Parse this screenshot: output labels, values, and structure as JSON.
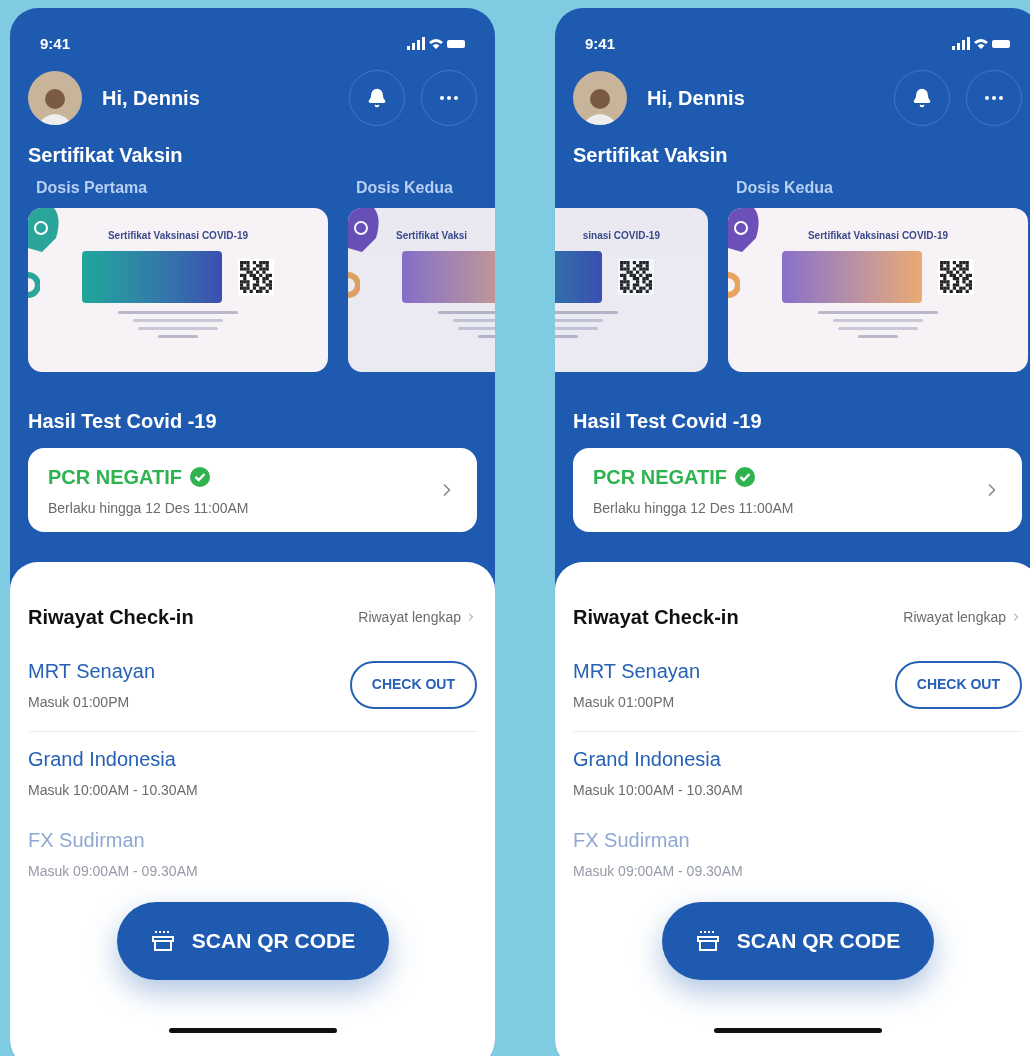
{
  "phones": [
    {
      "status_time": "9:41",
      "greeting": "Hi, Dennis",
      "vaccine_title": "Sertifikat Vaksin",
      "certificates": [
        {
          "label": "Dosis Pertama",
          "title": "Sertifikat Vaksinasi COVID-19",
          "kind": "teal",
          "selected": true
        },
        {
          "label": "Dosis Kedua",
          "title": "Sertifikat Vaksi",
          "kind": "sunset",
          "selected": false
        }
      ],
      "test_title": "Hasil Test Covid -19",
      "test_result": {
        "status": "PCR NEGATIF",
        "valid_until": "Berlaku hingga 12 Des 11:00AM"
      },
      "history": {
        "title": "Riwayat Check-in",
        "link": "Riwayat lengkap",
        "items": [
          {
            "place": "MRT Senayan",
            "time": "Masuk 01:00PM",
            "action": "CHECK OUT",
            "faded": false
          },
          {
            "place": "Grand Indonesia",
            "time": "Masuk 10:00AM - 10.30AM",
            "faded": false
          },
          {
            "place": "FX Sudirman",
            "time": "Masuk 09:00AM - 09.30AM",
            "faded": true
          }
        ]
      },
      "scan_button": "SCAN QR CODE"
    },
    {
      "status_time": "9:41",
      "greeting": "Hi, Dennis",
      "vaccine_title": "Sertifikat Vaksin",
      "certificates": [
        {
          "title": "sinasi COVID-19",
          "kind": "teal",
          "selected": false
        },
        {
          "label": "Dosis Kedua",
          "title": "Sertifikat Vaksinasi COVID-19",
          "kind": "sunset",
          "selected": true
        }
      ],
      "test_title": "Hasil Test Covid -19",
      "test_result": {
        "status": "PCR NEGATIF",
        "valid_until": "Berlaku hingga 12 Des 11:00AM"
      },
      "history": {
        "title": "Riwayat Check-in",
        "link": "Riwayat lengkap",
        "items": [
          {
            "place": "MRT Senayan",
            "time": "Masuk 01:00PM",
            "action": "CHECK OUT",
            "faded": false
          },
          {
            "place": "Grand Indonesia",
            "time": "Masuk 10:00AM - 10.30AM",
            "faded": false
          },
          {
            "place": "FX Sudirman",
            "time": "Masuk 09:00AM - 09.30AM",
            "faded": true
          }
        ]
      },
      "scan_button": "SCAN QR CODE"
    }
  ]
}
